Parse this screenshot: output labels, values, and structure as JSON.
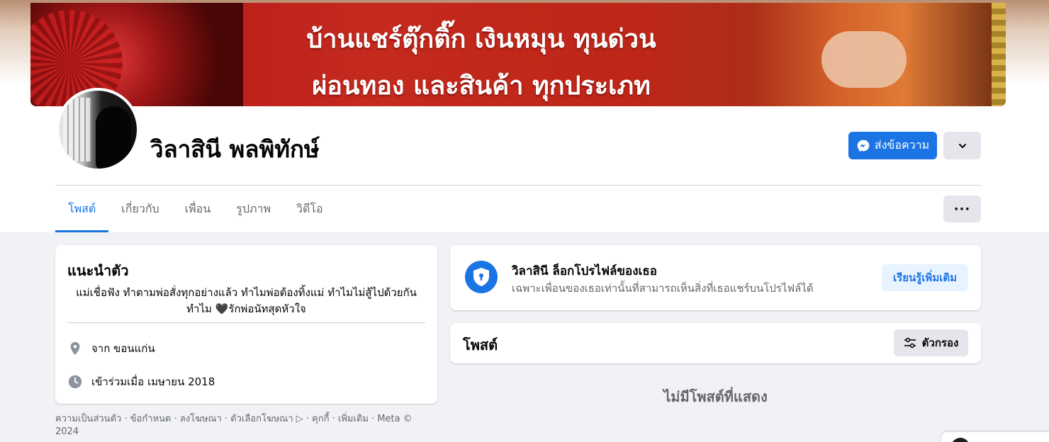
{
  "cover": {
    "line1": "บ้านแชร์ตุ๊กติ๊ก เงินหมุน ทุนด่วน",
    "line2": "ผ่อนทอง และสินค้า ทุกประเภท"
  },
  "profile": {
    "name": "วิลาสินี พลพิทักษ์",
    "message_button": "ส่งข้อความ"
  },
  "tabs": [
    {
      "label": "โพสต์",
      "active": true
    },
    {
      "label": "เกี่ยวกับ",
      "active": false
    },
    {
      "label": "เพื่อน",
      "active": false
    },
    {
      "label": "รูปภาพ",
      "active": false
    },
    {
      "label": "วิดีโอ",
      "active": false
    }
  ],
  "tabs_more_label": "···",
  "intro": {
    "title": "แนะนำตัว",
    "bio": "แม่เชื่อฟัง ทำตามพ่อสั่งทุกอย่างแล้ว ทำไมพ่อต้องทิ้งแม่ ทำไมไม่สู้ไปด้วยกัน ทำไม 🖤รักพ่อนัทสุดหัวใจ",
    "from": "จาก ขอนแก่น",
    "joined": "เข้าร่วมเมื่อ เมษายน 2018"
  },
  "footer": "ความเป็นส่วนตัว · ข้อกำหนด · ลงโฆษณา · ตัวเลือกโฆษณา ▷ · คุกกี้ · เพิ่มเติม · Meta © 2024",
  "locked": {
    "title": "วิลาสินี ล็อกโปรไฟล์ของเธอ",
    "subtitle": "เฉพาะเพื่อนของเธอเท่านั้นที่สามารถเห็นสิ่งที่เธอแชร์บนโปรไฟล์ได้",
    "learn_more": "เรียนรู้เพิ่มเติม"
  },
  "posts": {
    "title": "โพสต์",
    "filter_label": "ตัวกรอง",
    "empty_text": "ไม่มีโพสต์ที่แสดง"
  },
  "colors": {
    "accent": "#1b74e4",
    "background": "#f0f2f5"
  }
}
